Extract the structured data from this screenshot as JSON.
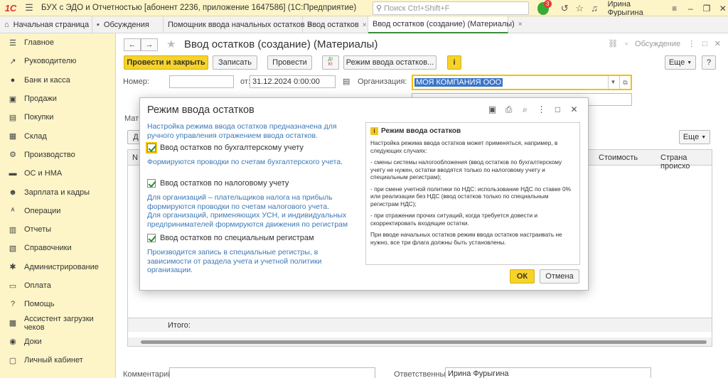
{
  "titlebar": {
    "logo": "1С",
    "app_title": "БУХ с ЭДО и Отчетностью [абонент 2236, приложение 1647586] (1С:Предприятие)",
    "search_placeholder": "Поиск Ctrl+Shift+F",
    "notif_count": "3",
    "user": "Ирина Фурыгина"
  },
  "tabs": [
    {
      "label": "Начальная страница"
    },
    {
      "label": "Обсуждения"
    },
    {
      "label": "Помощник ввода начальных остатков",
      "close": "×"
    },
    {
      "label": "Ввод остатков",
      "close": "×"
    },
    {
      "label": "Ввод остатков (создание) (Материалы)",
      "close": "×"
    }
  ],
  "sidebar": {
    "items": [
      {
        "label": "Главное",
        "icon": "menu-icon"
      },
      {
        "label": "Руководителю",
        "icon": "chart-icon"
      },
      {
        "label": "Банк и касса",
        "icon": "bank-icon"
      },
      {
        "label": "Продажи",
        "icon": "sales-icon"
      },
      {
        "label": "Покупки",
        "icon": "cart-icon"
      },
      {
        "label": "Склад",
        "icon": "warehouse-icon"
      },
      {
        "label": "Производство",
        "icon": "factory-icon"
      },
      {
        "label": "ОС и НМА",
        "icon": "truck-icon"
      },
      {
        "label": "Зарплата и кадры",
        "icon": "people-icon"
      },
      {
        "label": "Операции",
        "icon": "operations-icon"
      },
      {
        "label": "Отчеты",
        "icon": "reports-icon"
      },
      {
        "label": "Справочники",
        "icon": "book-icon"
      },
      {
        "label": "Администрирование",
        "icon": "gear-icon"
      },
      {
        "label": "Оплата",
        "icon": "payment-icon"
      },
      {
        "label": "Помощь",
        "icon": "help-icon"
      },
      {
        "label": "Ассистент загрузки чеков",
        "icon": "assistant-icon"
      },
      {
        "label": "Доки",
        "icon": "docs-icon"
      },
      {
        "label": "Личный кабинет",
        "icon": "cabinet-icon"
      }
    ]
  },
  "form": {
    "title": "Ввод остатков (создание) (Материалы)",
    "discussion": "Обсуждение",
    "buttons": {
      "post_close": "Провести и закрыть",
      "save": "Записать",
      "post": "Провести",
      "mode": "Режим ввода остатков...",
      "more": "Еще",
      "help": "?",
      "info": "i",
      "dtkt_top": "Дт",
      "dtkt_bottom": "Кт"
    },
    "number_label": "Номер:",
    "number_value": "",
    "date_label": "от:",
    "date_value": "31.12.2024  0:00:00",
    "org_label": "Организация:",
    "org_value": "МОЯ КОМПАНИЯ ООО",
    "comment_label": "Комментарий:",
    "comment_value": "",
    "responsible_label": "Ответственный:",
    "responsible_value": "Ирина Фурыгина",
    "table_tab": "Мат",
    "table_add": "Д",
    "table_more": "Еще",
    "table_columns": [
      "N",
      "Стоимость",
      "Страна происхо"
    ],
    "total_label": "Итого:"
  },
  "modal": {
    "title": "Режим ввода остатков",
    "desc": "Настройка режима ввода остатков предназначена для ручного управления отражением  ввода остатков.",
    "chk1_label": "Ввод остатков по бухгалтерскому учету",
    "chk1_checked": true,
    "note1": "Формируются проводки по счетам бухгалтерского учета.",
    "chk2_label": "Ввод остатков по налоговому учету",
    "chk2_checked": true,
    "note2": "Для организаций – плательщиков налога на прибыль формируются проводки по счетам налогового учета.\nДля организаций, применяющих УСН, и  индивидуальных предпринимателей формируются движения по регистрам налог...",
    "chk3_label": "Ввод остатков по специальным регистрам",
    "chk3_checked": true,
    "note3": "Производится запись в специальные регистры, в зависимости от раздела учета и учетной политики организации.",
    "help_title": "Режим ввода остатков",
    "help_p1": "Настройка режима ввода остатков может применяться, например, в следующих случаях:",
    "help_p2": "- смены системы налогообложения (ввод остатков по бухгалтерскому учету не нужен, остатки вводятся только по налоговому учету и специальным регистрам);",
    "help_p3": "- при смене учетной политики по НДС: использование НДС по ставке 0% или реализации без НДС (ввод остатков только по специальным регистрам НДС);",
    "help_p4": "- при отражении прочих ситуаций, когда требуется довести и скорректировать входящие остатки.",
    "help_p5": "При вводе начальных остатков режим ввода остатков настраивать не нужно, все три флага должны быть установлены.",
    "ok": "ОК",
    "cancel": "Отмена"
  }
}
